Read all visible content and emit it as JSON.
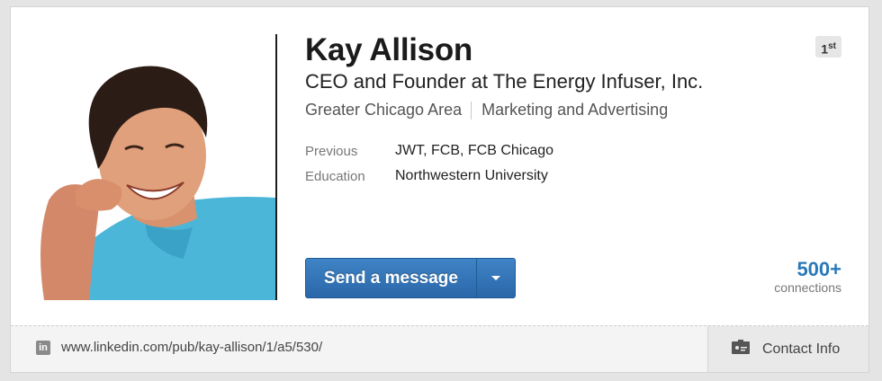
{
  "profile": {
    "name": "Kay Allison",
    "headline": "CEO and Founder at The Energy Infuser, Inc.",
    "location": "Greater Chicago Area",
    "industry": "Marketing and Advertising",
    "degree": "1",
    "degree_suffix": "st",
    "facts": [
      {
        "label": "Previous",
        "value": "JWT, FCB, FCB Chicago"
      },
      {
        "label": "Education",
        "value": "Northwestern University"
      }
    ]
  },
  "actions": {
    "send_message_label": "Send a message",
    "dropdown_icon": "chevron-down-icon"
  },
  "connections": {
    "count": "500+",
    "label": "connections"
  },
  "footer": {
    "url": "www.linkedin.com/pub/kay-allison/1/a5/530/",
    "contact_label": "Contact Info"
  },
  "colors": {
    "accent": "#2a78b8",
    "button": "#2a67a9"
  }
}
